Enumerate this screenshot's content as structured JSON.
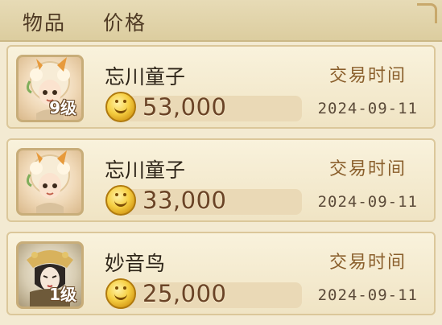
{
  "header": {
    "col_item": "物品",
    "col_price": "价格"
  },
  "rows": [
    {
      "name": "忘川童子",
      "level": "9级",
      "price": "53,000",
      "time_label": "交易时间",
      "date": "2024-09-11",
      "avatar_icon": "wangchuan-tongzi-portrait"
    },
    {
      "name": "忘川童子",
      "level": "",
      "price": "33,000",
      "time_label": "交易时间",
      "date": "2024-09-11",
      "avatar_icon": "wangchuan-tongzi-portrait"
    },
    {
      "name": "妙音鸟",
      "level": "1级",
      "price": "25,000",
      "time_label": "交易时间",
      "date": "2024-09-11",
      "avatar_icon": "miaoyin-niao-portrait"
    }
  ],
  "icons": {
    "currency": "gold-coin-icon"
  }
}
